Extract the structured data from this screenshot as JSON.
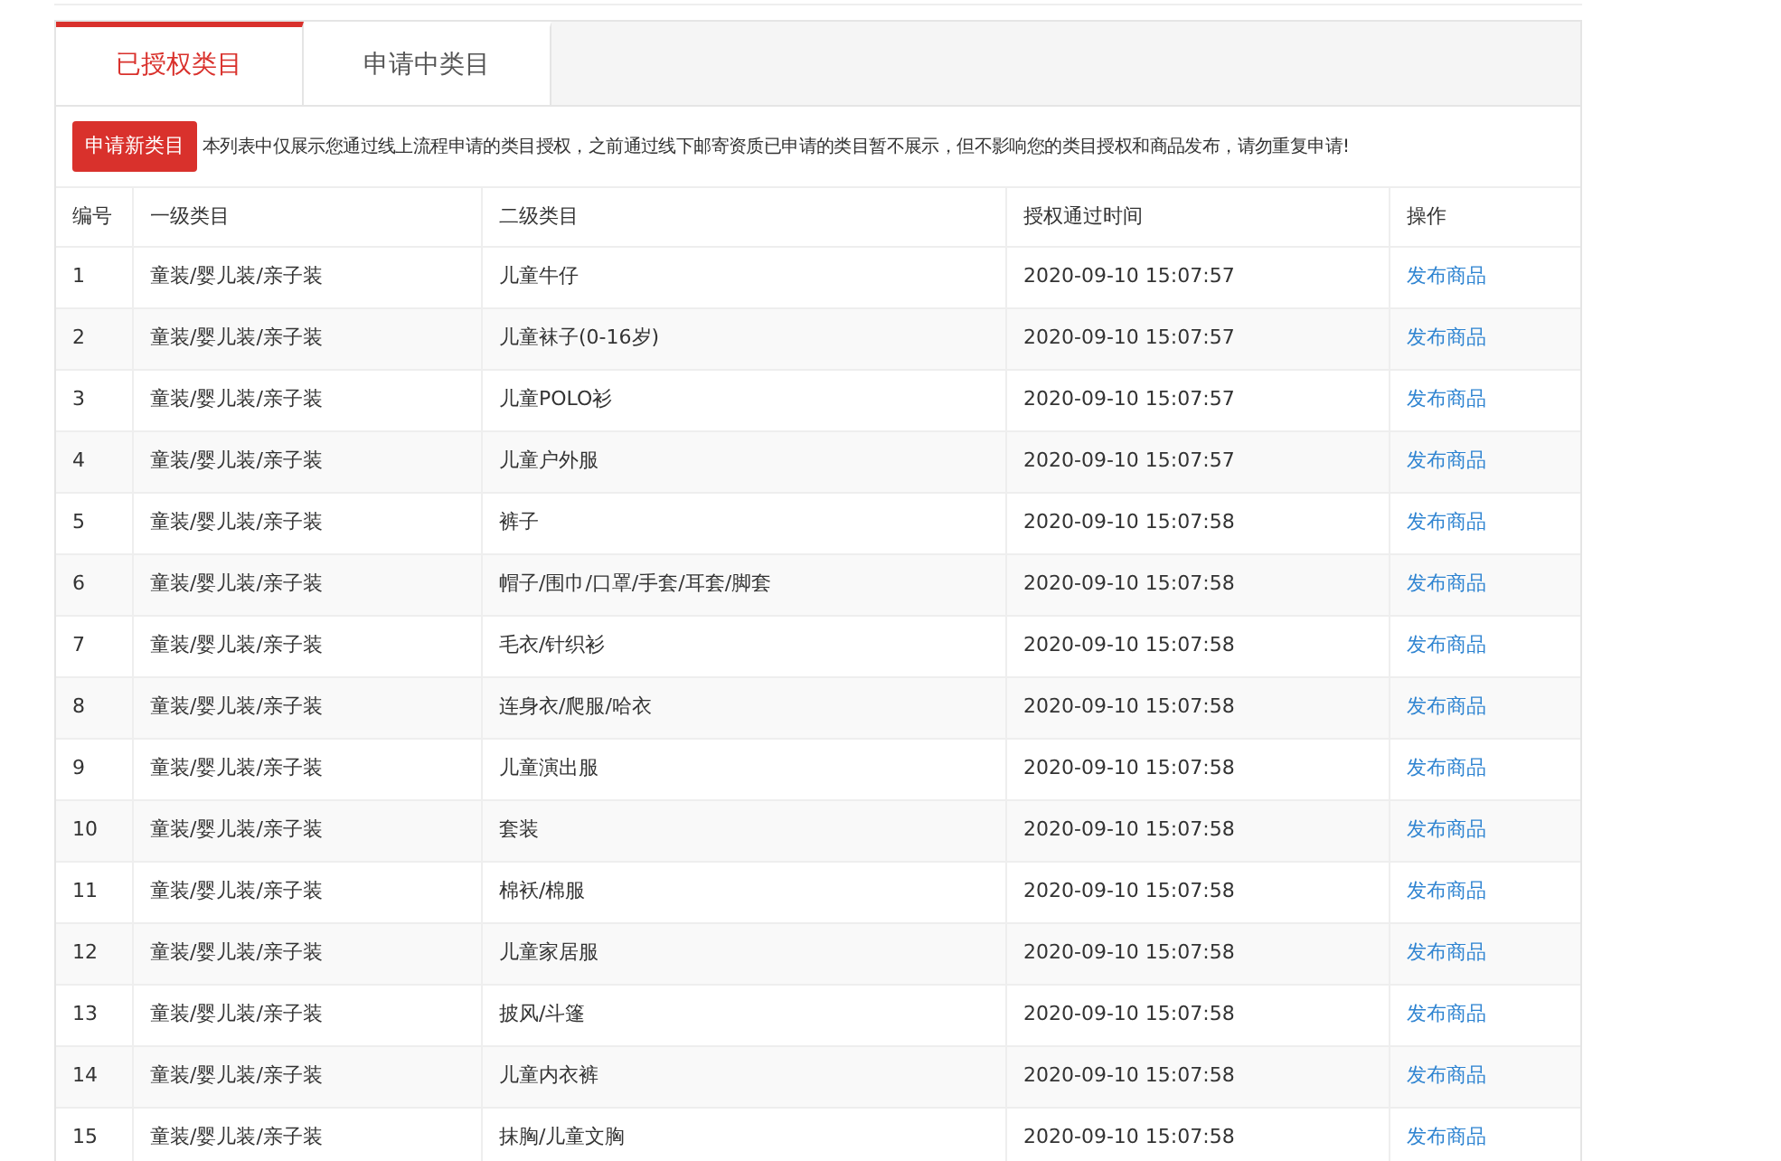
{
  "tabs": [
    {
      "label": "已授权类目",
      "selected": true
    },
    {
      "label": "申请中类目",
      "selected": false
    }
  ],
  "apply_button": "申请新类目",
  "notice": "本列表中仅展示您通过线上流程申请的类目授权，之前通过线下邮寄资质已申请的类目暂不展示，但不影响您的类目授权和商品发布，请勿重复申请!",
  "table": {
    "columns": [
      "编号",
      "一级类目",
      "二级类目",
      "授权通过时间",
      "操作"
    ],
    "rows": [
      {
        "no": "1",
        "level1": "童装/婴儿装/亲子装",
        "level2": "儿童牛仔",
        "time": "2020-09-10 15:07:57",
        "action": "发布商品"
      },
      {
        "no": "2",
        "level1": "童装/婴儿装/亲子装",
        "level2": "儿童袜子(0-16岁)",
        "time": "2020-09-10 15:07:57",
        "action": "发布商品"
      },
      {
        "no": "3",
        "level1": "童装/婴儿装/亲子装",
        "level2": "儿童POLO衫",
        "time": "2020-09-10 15:07:57",
        "action": "发布商品"
      },
      {
        "no": "4",
        "level1": "童装/婴儿装/亲子装",
        "level2": "儿童户外服",
        "time": "2020-09-10 15:07:57",
        "action": "发布商品"
      },
      {
        "no": "5",
        "level1": "童装/婴儿装/亲子装",
        "level2": "裤子",
        "time": "2020-09-10 15:07:58",
        "action": "发布商品"
      },
      {
        "no": "6",
        "level1": "童装/婴儿装/亲子装",
        "level2": "帽子/围巾/口罩/手套/耳套/脚套",
        "time": "2020-09-10 15:07:58",
        "action": "发布商品"
      },
      {
        "no": "7",
        "level1": "童装/婴儿装/亲子装",
        "level2": "毛衣/针织衫",
        "time": "2020-09-10 15:07:58",
        "action": "发布商品"
      },
      {
        "no": "8",
        "level1": "童装/婴儿装/亲子装",
        "level2": "连身衣/爬服/哈衣",
        "time": "2020-09-10 15:07:58",
        "action": "发布商品"
      },
      {
        "no": "9",
        "level1": "童装/婴儿装/亲子装",
        "level2": "儿童演出服",
        "time": "2020-09-10 15:07:58",
        "action": "发布商品"
      },
      {
        "no": "10",
        "level1": "童装/婴儿装/亲子装",
        "level2": "套装",
        "time": "2020-09-10 15:07:58",
        "action": "发布商品"
      },
      {
        "no": "11",
        "level1": "童装/婴儿装/亲子装",
        "level2": "棉袄/棉服",
        "time": "2020-09-10 15:07:58",
        "action": "发布商品"
      },
      {
        "no": "12",
        "level1": "童装/婴儿装/亲子装",
        "level2": "儿童家居服",
        "time": "2020-09-10 15:07:58",
        "action": "发布商品"
      },
      {
        "no": "13",
        "level1": "童装/婴儿装/亲子装",
        "level2": "披风/斗篷",
        "time": "2020-09-10 15:07:58",
        "action": "发布商品"
      },
      {
        "no": "14",
        "level1": "童装/婴儿装/亲子装",
        "level2": "儿童内衣裤",
        "time": "2020-09-10 15:07:58",
        "action": "发布商品"
      },
      {
        "no": "15",
        "level1": "童装/婴儿装/亲子装",
        "level2": "抹胸/儿童文胸",
        "time": "2020-09-10 15:07:58",
        "action": "发布商品"
      }
    ]
  }
}
